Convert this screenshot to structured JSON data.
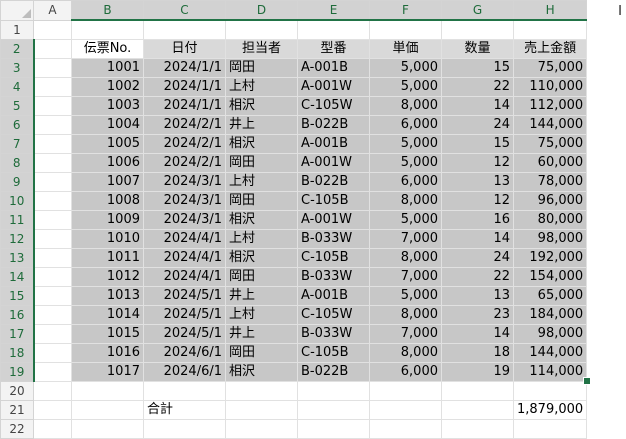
{
  "columns": [
    "A",
    "B",
    "C",
    "D",
    "E",
    "F",
    "G",
    "H"
  ],
  "rows": [
    "1",
    "2",
    "3",
    "4",
    "5",
    "6",
    "7",
    "8",
    "9",
    "10",
    "11",
    "12",
    "13",
    "14",
    "15",
    "16",
    "17",
    "18",
    "19",
    "20",
    "21",
    "22"
  ],
  "table": {
    "headers": [
      "伝票No.",
      "日付",
      "担当者",
      "型番",
      "単価",
      "数量",
      "売上金額"
    ],
    "rows": [
      [
        "1001",
        "2024/1/1",
        "岡田",
        "A-001B",
        "5,000",
        "15",
        "75,000"
      ],
      [
        "1002",
        "2024/1/1",
        "上村",
        "A-001W",
        "5,000",
        "22",
        "110,000"
      ],
      [
        "1003",
        "2024/1/1",
        "相沢",
        "C-105W",
        "8,000",
        "14",
        "112,000"
      ],
      [
        "1004",
        "2024/2/1",
        "井上",
        "B-022B",
        "6,000",
        "24",
        "144,000"
      ],
      [
        "1005",
        "2024/2/1",
        "相沢",
        "A-001B",
        "5,000",
        "15",
        "75,000"
      ],
      [
        "1006",
        "2024/2/1",
        "岡田",
        "A-001W",
        "5,000",
        "12",
        "60,000"
      ],
      [
        "1007",
        "2024/3/1",
        "上村",
        "B-022B",
        "6,000",
        "13",
        "78,000"
      ],
      [
        "1008",
        "2024/3/1",
        "岡田",
        "C-105B",
        "8,000",
        "12",
        "96,000"
      ],
      [
        "1009",
        "2024/3/1",
        "相沢",
        "A-001W",
        "5,000",
        "16",
        "80,000"
      ],
      [
        "1010",
        "2024/4/1",
        "上村",
        "B-033W",
        "7,000",
        "14",
        "98,000"
      ],
      [
        "1011",
        "2024/4/1",
        "相沢",
        "C-105B",
        "8,000",
        "24",
        "192,000"
      ],
      [
        "1012",
        "2024/4/1",
        "岡田",
        "B-033W",
        "7,000",
        "22",
        "154,000"
      ],
      [
        "1013",
        "2024/5/1",
        "井上",
        "A-001B",
        "5,000",
        "13",
        "65,000"
      ],
      [
        "1014",
        "2024/5/1",
        "上村",
        "C-105W",
        "8,000",
        "23",
        "184,000"
      ],
      [
        "1015",
        "2024/5/1",
        "井上",
        "B-033W",
        "7,000",
        "14",
        "98,000"
      ],
      [
        "1016",
        "2024/6/1",
        "岡田",
        "C-105B",
        "8,000",
        "18",
        "144,000"
      ],
      [
        "1017",
        "2024/6/1",
        "相沢",
        "B-022B",
        "6,000",
        "19",
        "114,000"
      ]
    ]
  },
  "total": {
    "label": "合計",
    "value": "1,879,000"
  },
  "cursor_glyph": "I",
  "colors": {
    "selection": "#217346",
    "data_fill": "#c7c7c7",
    "header_fill": "#d9d9d9"
  }
}
